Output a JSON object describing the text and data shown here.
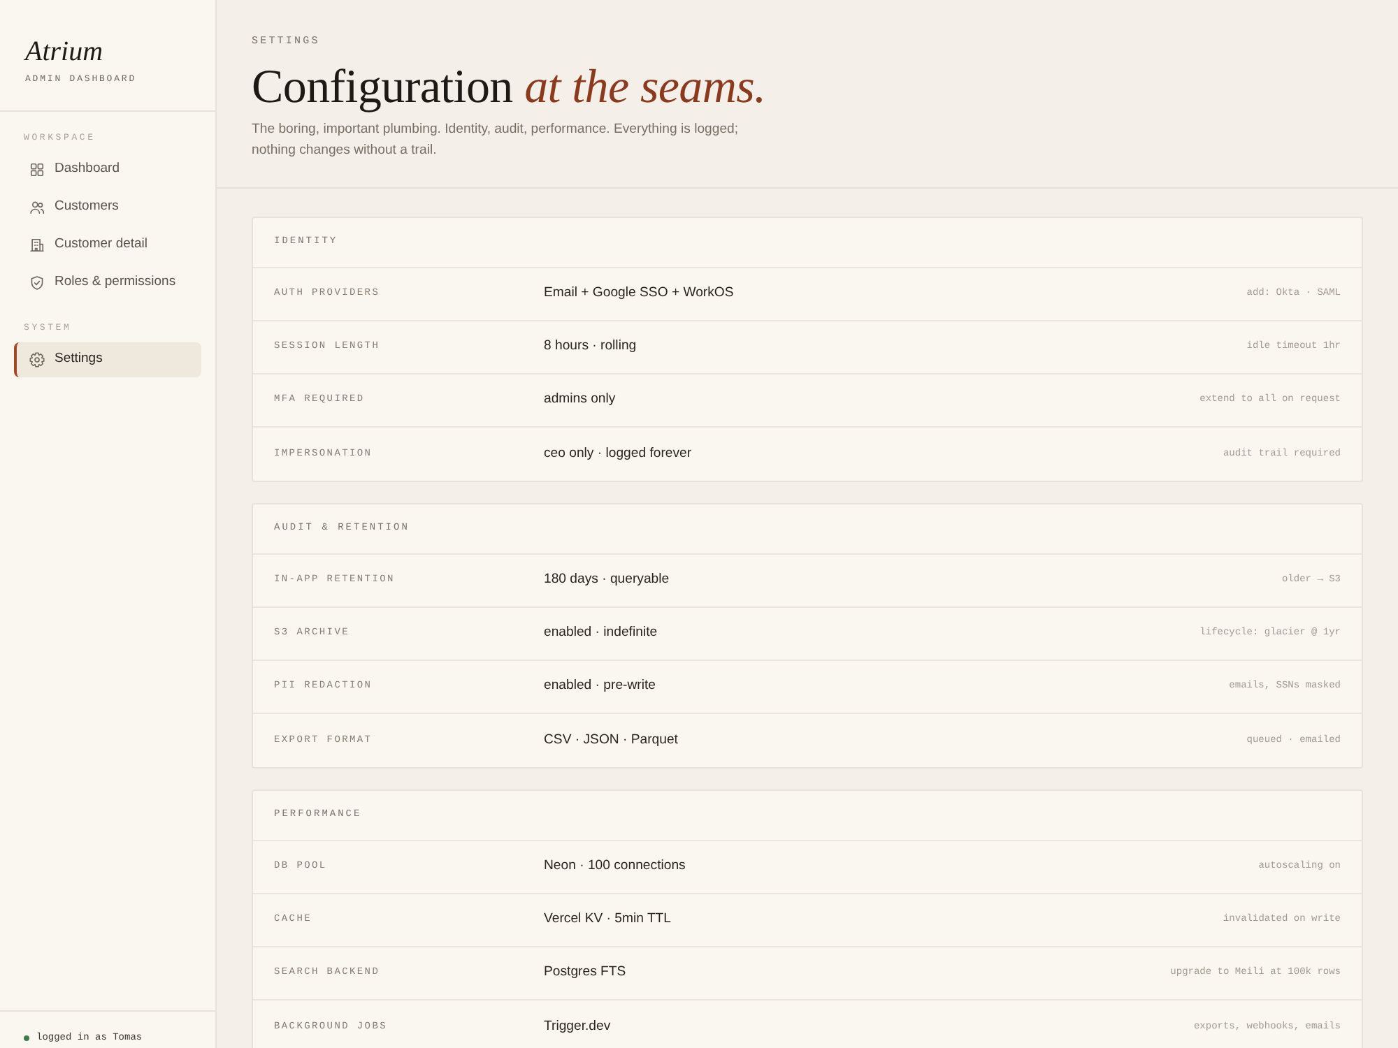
{
  "sidebar": {
    "brand": {
      "title": "Atrium",
      "subtitle": "ADMIN DASHBOARD"
    },
    "sections": [
      {
        "label": "WORKSPACE",
        "items": [
          {
            "label": "Dashboard",
            "selected": false
          },
          {
            "label": "Customers",
            "selected": false
          },
          {
            "label": "Customer detail",
            "selected": false
          },
          {
            "label": "Roles & permissions",
            "selected": false
          }
        ]
      },
      {
        "label": "SYSTEM",
        "items": [
          {
            "label": "Settings",
            "selected": true
          }
        ]
      }
    ],
    "footer": {
      "text": "logged in as Tomas",
      "online": true
    }
  },
  "header": {
    "eyebrow": "SETTINGS",
    "title": "Configuration *at the seams.*",
    "description": "The boring, important plumbing. Identity, audit, performance. Everything is logged; nothing changes without a trail."
  },
  "sections": [
    {
      "title": "IDENTITY",
      "rows": [
        {
          "name": "AUTH PROVIDERS",
          "value": "Email + Google SSO + WorkOS",
          "note": "add: Okta · SAML"
        },
        {
          "name": "SESSION LENGTH",
          "value": "8 hours · rolling",
          "note": "idle timeout 1hr"
        },
        {
          "name": "MFA REQUIRED",
          "value": "admins only",
          "note": "extend to all on request"
        },
        {
          "name": "IMPERSONATION",
          "value": "ceo only · logged forever",
          "note": "audit trail required"
        }
      ]
    },
    {
      "title": "AUDIT & RETENTION",
      "rows": [
        {
          "name": "IN-APP RETENTION",
          "value": "180 days · queryable",
          "note": "older → S3"
        },
        {
          "name": "S3 ARCHIVE",
          "value": "enabled · indefinite",
          "note": "lifecycle: glacier @ 1yr"
        },
        {
          "name": "PII REDACTION",
          "value": "enabled · pre-write",
          "note": "emails, SSNs masked"
        },
        {
          "name": "EXPORT FORMAT",
          "value": "CSV · JSON · Parquet",
          "note": "queued · emailed"
        }
      ]
    },
    {
      "title": "PERFORMANCE",
      "rows": [
        {
          "name": "DB POOL",
          "value": "Neon · 100 connections",
          "note": "autoscaling on"
        },
        {
          "name": "CACHE",
          "value": "Vercel KV · 5min TTL",
          "note": "invalidated on write"
        },
        {
          "name": "SEARCH BACKEND",
          "value": "Postgres FTS",
          "note": "upgrade to Meili at 100k rows"
        },
        {
          "name": "BACKGROUND JOBS",
          "value": "Trigger.dev",
          "note": "exports, webhooks, emails"
        }
      ]
    }
  ]
}
